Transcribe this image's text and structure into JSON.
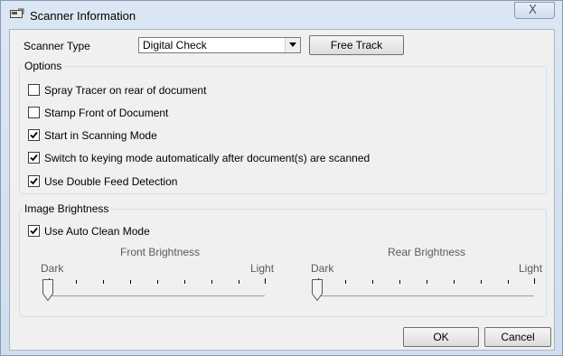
{
  "window": {
    "title": "Scanner Information",
    "close_glyph": "X"
  },
  "scanner": {
    "type_label": "Scanner Type",
    "type_value": "Digital Check",
    "free_track_label": "Free Track"
  },
  "options": {
    "title": "Options",
    "items": [
      {
        "label": "Spray Tracer on rear of document",
        "checked": false
      },
      {
        "label": "Stamp Front of Document",
        "checked": false
      },
      {
        "label": "Start in Scanning Mode",
        "checked": true
      },
      {
        "label": "Switch to keying mode automatically after document(s) are scanned",
        "checked": true
      },
      {
        "label": "Use Double Feed Detection",
        "checked": true
      }
    ]
  },
  "brightness": {
    "title": "Image Brightness",
    "auto_clean": {
      "label": "Use Auto Clean Mode",
      "checked": true
    },
    "front": {
      "title": "Front Brightness",
      "min_label": "Dark",
      "max_label": "Light",
      "value": 0
    },
    "rear": {
      "title": "Rear Brightness",
      "min_label": "Dark",
      "max_label": "Light",
      "value": 0
    }
  },
  "footer": {
    "ok_label": "OK",
    "cancel_label": "Cancel"
  },
  "icons": {
    "title": "scanner-app-icon",
    "close": "close-icon",
    "dropdown": "chevron-down-icon",
    "check": "check-icon"
  }
}
